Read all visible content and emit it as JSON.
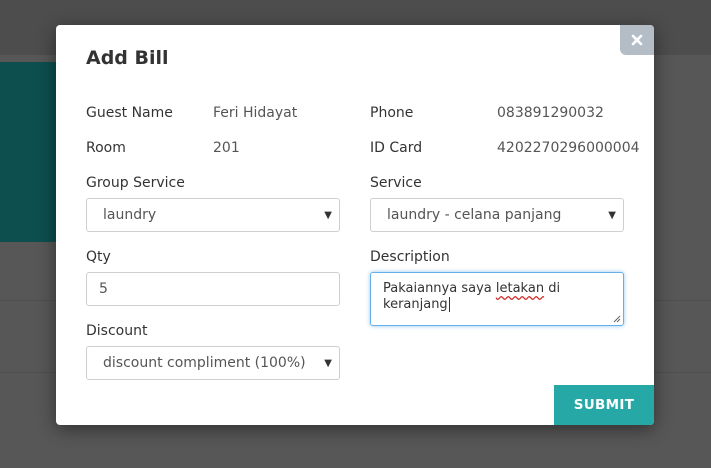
{
  "modal": {
    "title": "Add Bill",
    "close_icon": "close-icon",
    "guest_name": {
      "label": "Guest Name",
      "value": "Feri Hidayat"
    },
    "phone": {
      "label": "Phone",
      "value": "083891290032"
    },
    "room": {
      "label": "Room",
      "value": "201"
    },
    "id_card": {
      "label": "ID Card",
      "value": "4202270296000004"
    },
    "group_service": {
      "label": "Group Service",
      "selected": "laundry"
    },
    "service": {
      "label": "Service",
      "selected": "laundry - celana panjang"
    },
    "qty": {
      "label": "Qty",
      "value": "5"
    },
    "description": {
      "label": "Description",
      "value_before": "Pakaiannya saya ",
      "value_misspelled": "letakan",
      "value_after": " di keranjang"
    },
    "discount": {
      "label": "Discount",
      "selected": "discount compliment (100%)"
    },
    "submit_label": "SUBMIT"
  },
  "colors": {
    "accent": "#26a9a6",
    "close_bg": "#b4bdc6",
    "focus_border": "#66afe9",
    "overlay": "#575757"
  }
}
